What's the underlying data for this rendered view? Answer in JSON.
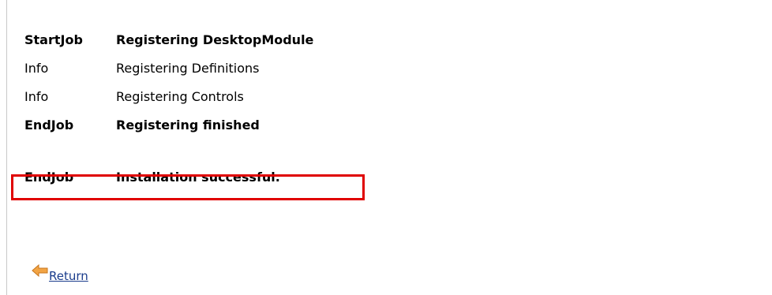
{
  "log": {
    "rows": [
      {
        "type": "StartJob",
        "message": "Registering DesktopModule"
      },
      {
        "type": "Info",
        "message": "Registering Definitions"
      },
      {
        "type": "Info",
        "message": "Registering Controls"
      },
      {
        "type": "EndJob",
        "message": "Registering finished"
      },
      {
        "type": "EndJob",
        "message": "Installation successful."
      }
    ]
  },
  "return_link": {
    "label": "Return",
    "icon": "back-arrow-icon"
  },
  "colors": {
    "highlight_border": "#e00000",
    "link": "#1a3c8c",
    "icon": "#f0a040"
  }
}
